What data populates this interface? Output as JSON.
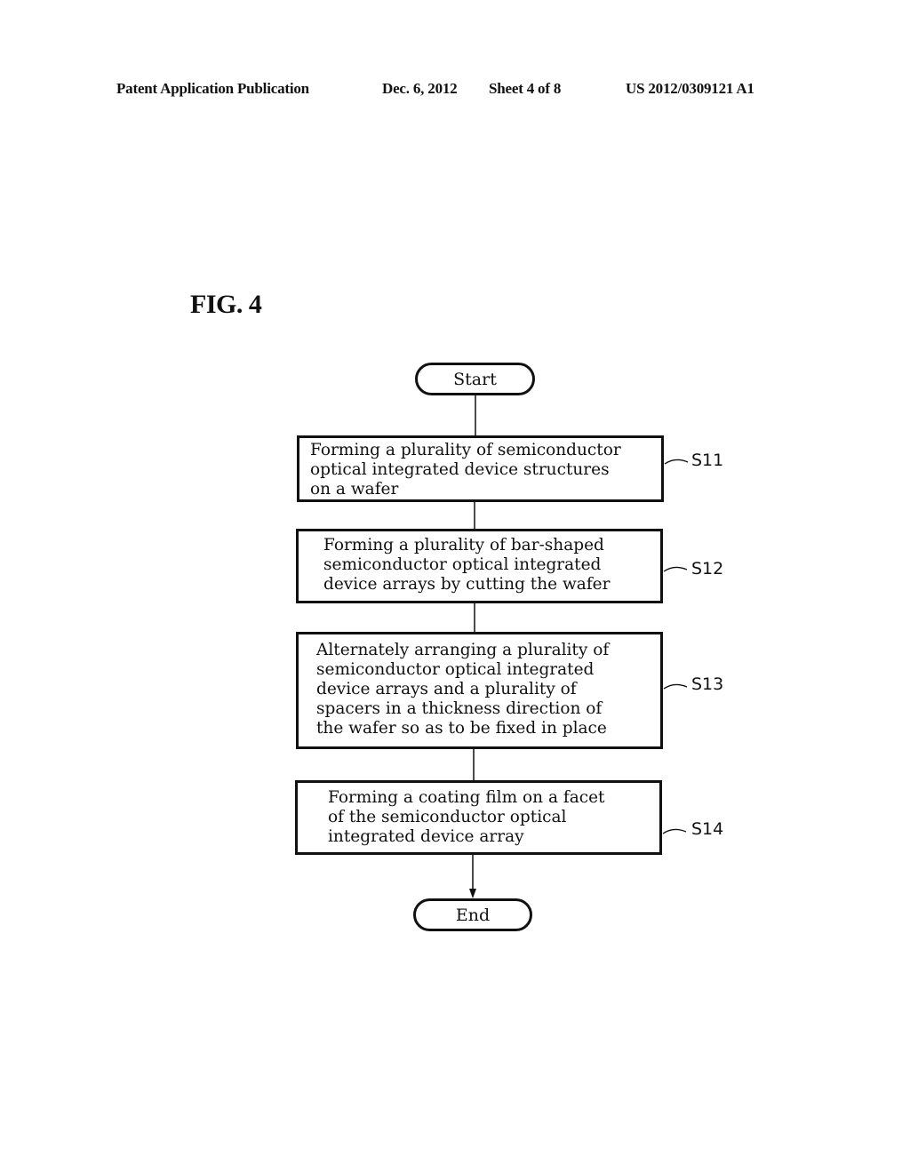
{
  "header": {
    "publication_type": "Patent Application Publication",
    "date": "Dec. 6, 2012",
    "sheet": "Sheet 4 of 8",
    "publication_number": "US 2012/0309121 A1"
  },
  "figure": {
    "label": "FIG. 4",
    "start_label": "Start",
    "end_label": "End",
    "steps": [
      {
        "ref": "S11",
        "text": "Forming a plurality of semiconductor\noptical integrated device structures\non a wafer"
      },
      {
        "ref": "S12",
        "text": "Forming a plurality of bar-shaped\nsemiconductor optical integrated\ndevice arrays by cutting the wafer"
      },
      {
        "ref": "S13",
        "text": "Alternately arranging a plurality of\nsemiconductor optical integrated\ndevice arrays and a plurality of\nspacers in a thickness direction of\nthe wafer so as to be fixed in place"
      },
      {
        "ref": "S14",
        "text": "Forming a coating film on a facet\nof the semiconductor optical\nintegrated device array"
      }
    ]
  }
}
